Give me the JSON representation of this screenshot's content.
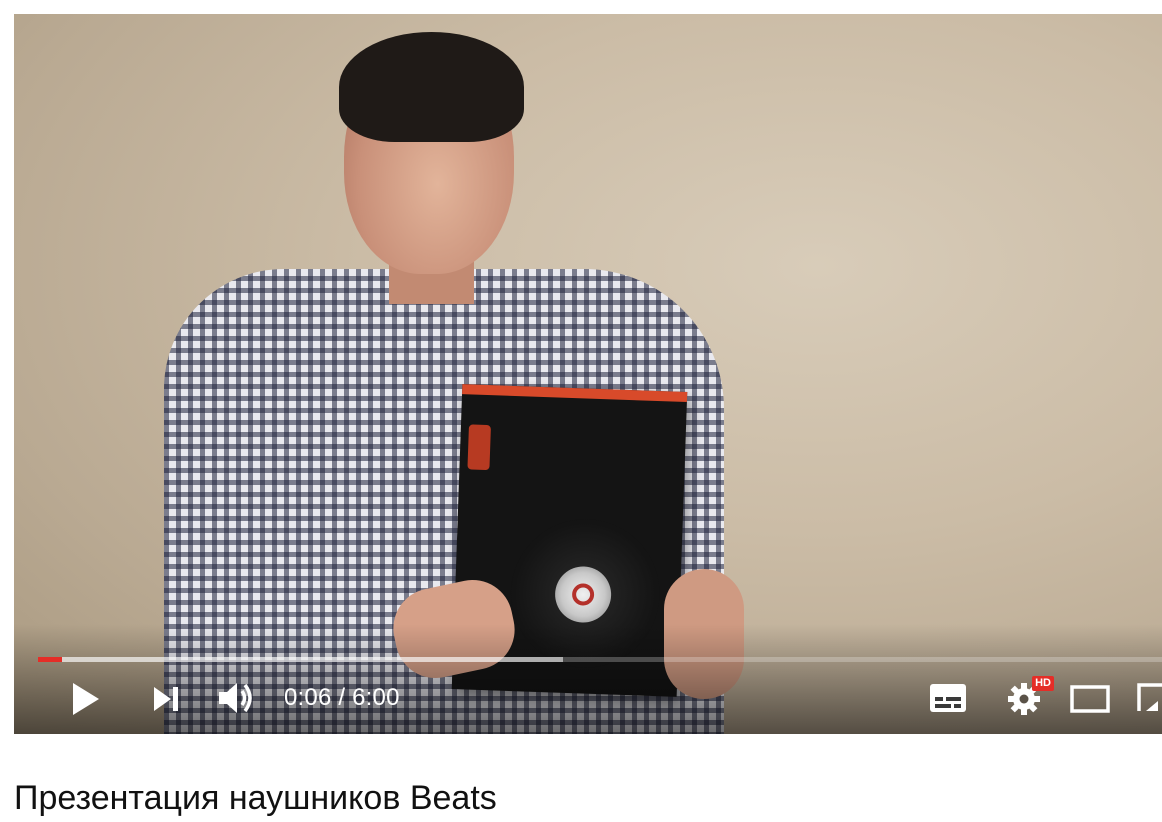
{
  "video": {
    "current_time": "0:06",
    "separator": " / ",
    "duration": "6:00",
    "progress_played_fraction": 0.021,
    "progress_buffered_fraction": 0.467,
    "hd_badge": "HD"
  },
  "controls": {
    "icons": [
      "play-icon",
      "next-icon",
      "volume-icon",
      "subtitles-icon",
      "settings-icon",
      "theater-mode-icon",
      "fullscreen-icon"
    ]
  },
  "page": {
    "title": "Презентация наушников Beats"
  },
  "colors": {
    "progress_played": "#e52d27",
    "hd_badge": "#e52d27",
    "controls": "#ffffff"
  }
}
